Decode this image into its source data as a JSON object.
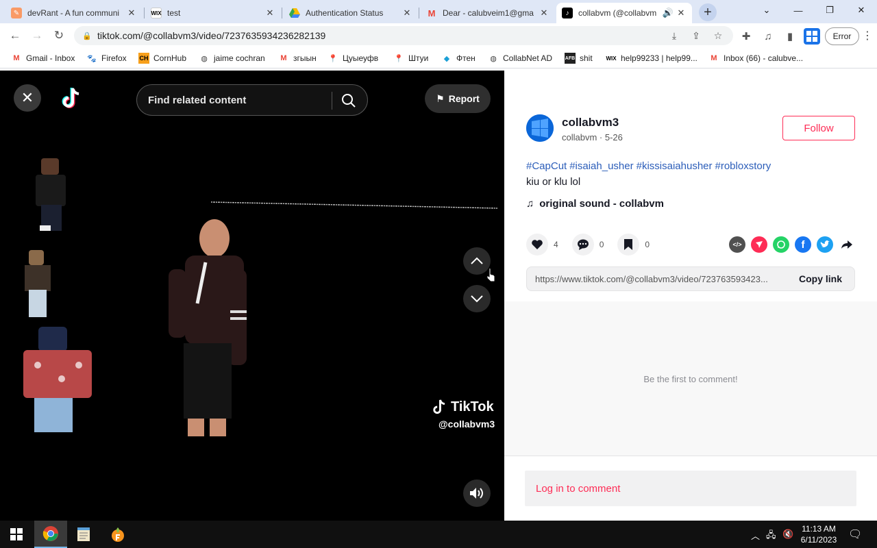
{
  "browser": {
    "tabs": [
      {
        "title": "devRant - A fun communi",
        "icon": "devrant-icon",
        "active": false
      },
      {
        "title": "test",
        "icon": "wix-icon",
        "active": false
      },
      {
        "title": "Authentication Status",
        "icon": "google-drive-icon",
        "active": false
      },
      {
        "title": "Dear - calubveim1@gma",
        "icon": "gmail-icon",
        "active": false
      },
      {
        "title": "collabvm (@collabvm",
        "icon": "tiktok-icon",
        "active": true
      }
    ],
    "url": "tiktok.com/@collabvm3/video/7237635934236282139",
    "error_label": "Error",
    "bookmarks": [
      {
        "label": "Gmail - Inbox",
        "icon": "gmail-icon"
      },
      {
        "label": "Firefox",
        "icon": "firefox-icon"
      },
      {
        "label": "CornHub",
        "icon": "ch-icon"
      },
      {
        "label": "jaime cochran",
        "icon": "globe-icon"
      },
      {
        "label": "згыын",
        "icon": "gmail-icon"
      },
      {
        "label": "Цуыеуфв",
        "icon": "maps-icon"
      },
      {
        "label": "Штуи",
        "icon": "maps-icon"
      },
      {
        "label": "Фтен",
        "icon": "diamond-icon"
      },
      {
        "label": "CollabNet AD",
        "icon": "globe-icon"
      },
      {
        "label": "shit",
        "icon": "afb-icon"
      },
      {
        "label": "help99233 | help99...",
        "icon": "wix-icon"
      },
      {
        "label": "Inbox (66) - calubve...",
        "icon": "gmail-icon"
      }
    ]
  },
  "video": {
    "search_placeholder": "Find related content",
    "report_label": "Report",
    "watermark_brand": "TikTok",
    "watermark_user": "@collabvm3"
  },
  "post": {
    "username": "collabvm3",
    "nickname": "collabvm",
    "date": "5-26",
    "follow_label": "Follow",
    "hashtags": [
      "#CapCut",
      "#isaiah_usher",
      "#kissisaiahusher",
      "#robloxstory"
    ],
    "description": "kiu or klu lol",
    "music": "original sound - collabvm",
    "likes": "4",
    "comments": "0",
    "saves": "0",
    "share_url": "https://www.tiktok.com/@collabvm3/video/723763593423...",
    "copy_link_label": "Copy link",
    "empty_comments": "Be the first to comment!",
    "login_prompt": "Log in to comment"
  },
  "taskbar": {
    "time": "11:13 AM",
    "date": "6/11/2023"
  },
  "colors": {
    "tiktok_red": "#fe2c55",
    "hashtag_blue": "#2b5db9",
    "tab_bar": "#dfe7f6"
  }
}
